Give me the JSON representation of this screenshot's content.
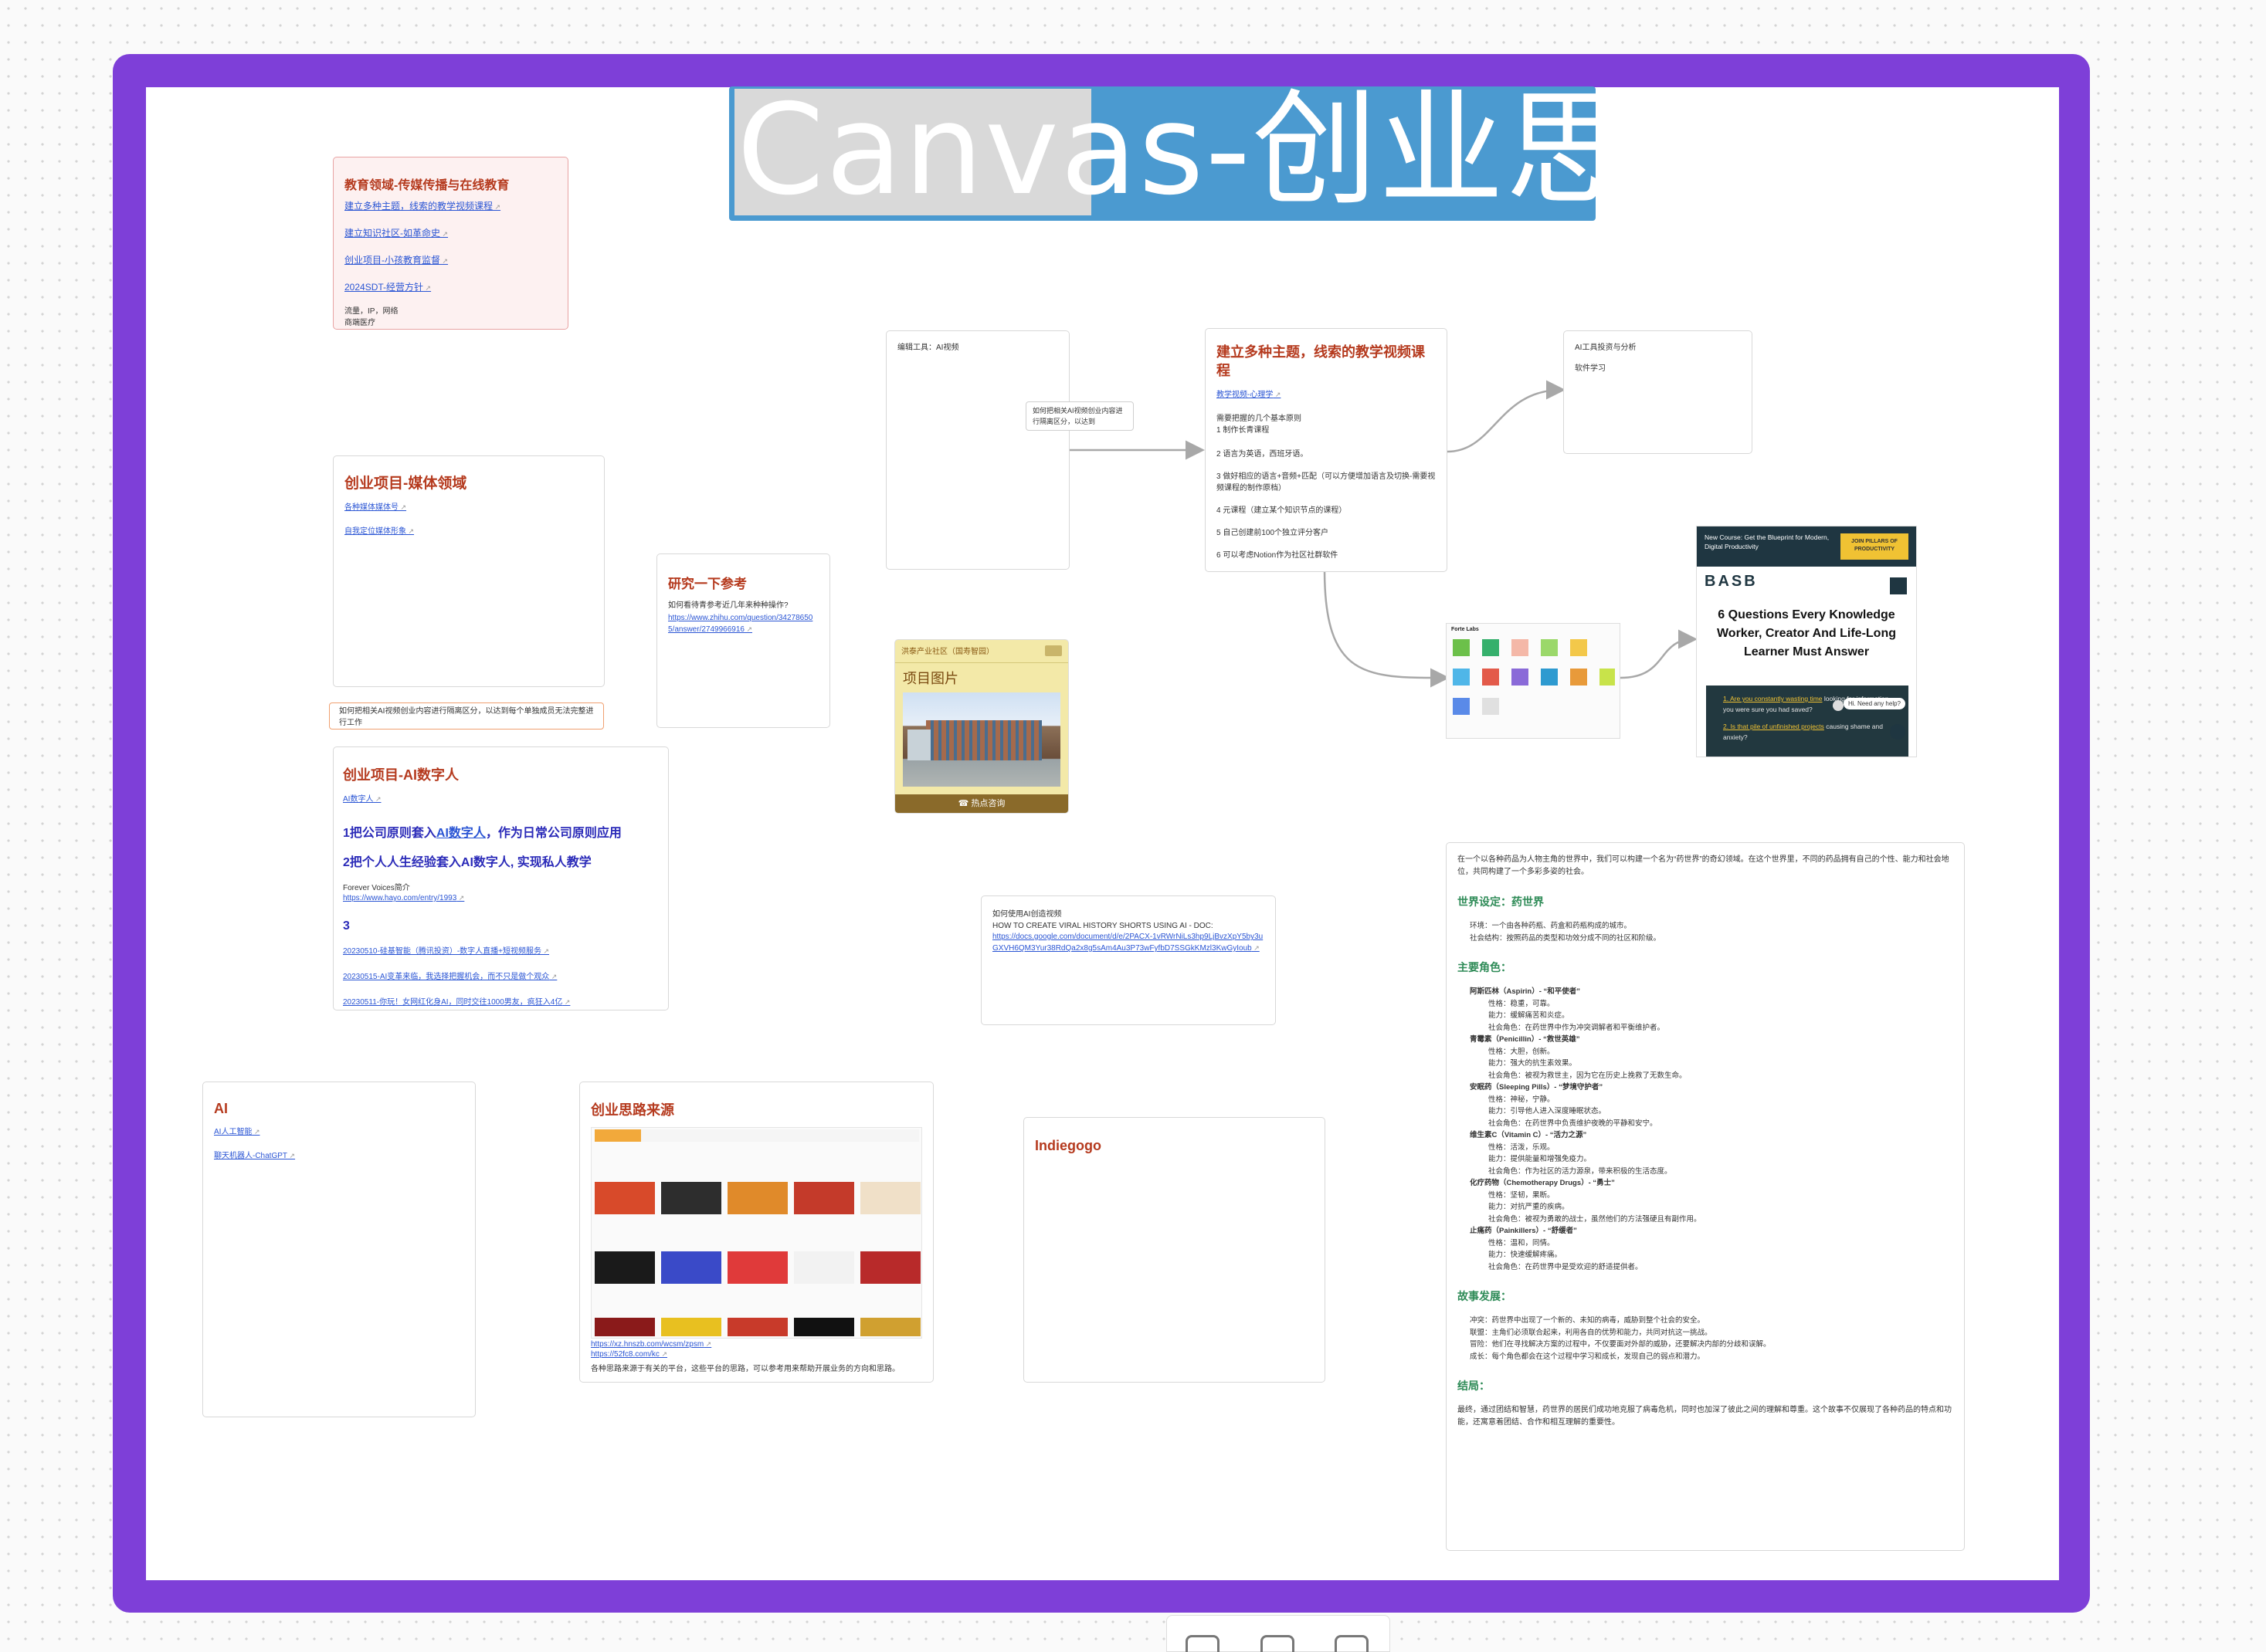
{
  "page": {
    "title": "Canvas-创业思路",
    "title_part1": "Canvas",
    "title_part2": "-创业思路"
  },
  "edu": {
    "title": "教育领域-传媒传播与在线教育",
    "links": [
      "建立多种主题，线索的教学视频课程",
      "建立知识社区-如革命史",
      "创业项目-小孩教育监督",
      "2024SDT-经营方针"
    ],
    "note1": "流量，IP，网络",
    "note2": "商端医疗"
  },
  "media": {
    "title": "创业项目-媒体领域",
    "links": [
      "各种媒体媒体号",
      "自我定位媒体形象"
    ]
  },
  "orange_note": "如何把相关AI视频创业内容进行隔离区分，以达到每个单独成员无法完整进行工作",
  "research": {
    "title": "研究一下参考",
    "text": "如何看待青参考近几年来种种操作?",
    "link": "https://www.zhihu.com/question/342786505/answer/2749966916"
  },
  "ai_human": {
    "title": "创业项目-AI数字人",
    "link1": "AI数字人",
    "line1_prefix": "1把公司原则套入",
    "line1_link": "AI数字人",
    "line1_suffix": "，作为日常公司原则应用",
    "line2": "2把个人人生经验套入AI数字人, 实现私人教学",
    "fv_label": "Forever Voices简介",
    "fv_link": "https://www.hayo.com/entry/1993",
    "num3": "3",
    "links": [
      "20230510-硅基智能（腾讯投资）-数字人直播+短视频服务",
      "20230515-AI变革来临，我选择把握机会，而不只是做个观众",
      "20230511-你玩！女网红化身AI，同时交往1000男友，疯狂入4亿"
    ]
  },
  "edit_tool": {
    "label": "编辑工具：AI视频"
  },
  "small_note": "如何把相关AI视频创业内容进行隔离区分，以达到",
  "project_card": {
    "header": "洪泰产业社区（国寿智园）",
    "label": "项目图片",
    "footer": "☎ 热点咨询"
  },
  "course": {
    "title": "建立多种主题，线索的教学视频课程",
    "link": "教学视频-心理学",
    "lines": [
      "需要把握的几个基本原则",
      "1 制作长青课程",
      "2 语言为英语，西班牙语。",
      "3 做好相应的语言+音频+匹配（可以方便增加语言及切换-需要视频课程的制作原档）",
      "4 元课程（建立某个知识节点的课程）",
      "5 自己创建前100个独立评分客户",
      "6 可以考虑Notion作为社区社群软件"
    ]
  },
  "ai_tools": {
    "line1": "AI工具投资与分析",
    "line2": "软件学习"
  },
  "basb": {
    "banner": "New Course: Get the Blueprint for Modern, Digital Productivity",
    "cta": "JOIN PILLARS OF PRODUCTIVITY",
    "logo": "BASB",
    "headline": "6 Questions Every Knowledge Worker, Creator And Life-Long Learner Must Answer",
    "q1_link": "1. Are you constantly wasting time",
    "q1_rest": " looking for information you were sure you had saved?",
    "q2_link": "2. Is that pile of unfinished projects",
    "q2_rest": " causing shame and anxiety?",
    "chat": "Hi. Need any help?"
  },
  "forte": {
    "title": "Forte Labs"
  },
  "viral": {
    "line1": "如何使用AI创造视频",
    "line2": "HOW TO CREATE VIRAL HISTORY SHORTS USING AI - DOC:",
    "link": "https://docs.google.com/document/d/e/2PACX-1vRWrNiLs3hp9LjBvzXpY5by3uGXVH6QM3Yur38RdQa2x8g5sAm4Au3P73wFyfbD7SSGkKMzl3KwGyIoub"
  },
  "ai_card": {
    "title": "AI",
    "links": [
      "AI人工智能",
      "聊天机器人-ChatGPT"
    ]
  },
  "source": {
    "title": "创业思路来源",
    "links": [
      "https://xz.hnszb.com/wcsm/zpsm",
      "https://52fc8.com/kc"
    ],
    "footer": "各种思路来源于有关的平台，这些平台的思路，可以参考用来帮助开展业务的方向和思路。"
  },
  "indiegogo": {
    "title": "Indiegogo"
  },
  "story": {
    "intro": "在一个以各种药品为人物主角的世界中，我们可以构建一个名为“药世界”的奇幻领域。在这个世界里，不同的药品拥有自己的个性、能力和社会地位，共同构建了一个多彩多姿的社会。",
    "world_title": "世界设定：药世界",
    "world": [
      "环境：一个由各种药瓶、药盒和药瓶构成的城市。",
      "社会结构：按照药品的类型和功效分成不同的社区和阶级。"
    ],
    "chars_title": "主要角色：",
    "chars": [
      {
        "name": "阿斯匹林（Aspirin）- “和平使者”",
        "attrs": [
          "性格：稳重，可靠。",
          "能力：缓解痛苦和炎症。",
          "社会角色：在药世界中作为冲突调解者和平衡维护者。"
        ]
      },
      {
        "name": "青霉素（Penicillin）- “救世英雄”",
        "attrs": [
          "性格：大胆，创新。",
          "能力：强大的抗生素效果。",
          "社会角色：被视为救世主，因为它在历史上挽救了无数生命。"
        ]
      },
      {
        "name": "安眠药（Sleeping Pills）- “梦境守护者”",
        "attrs": [
          "性格：神秘，宁静。",
          "能力：引导他人进入深度睡眠状态。",
          "社会角色：在药世界中负责维护夜晚的平静和安宁。"
        ]
      },
      {
        "name": "维生素C（Vitamin C）- “活力之源”",
        "attrs": [
          "性格：活泼，乐观。",
          "能力：提供能量和增强免疫力。",
          "社会角色：作为社区的活力源泉，带来积极的生活态度。"
        ]
      },
      {
        "name": "化疗药物（Chemotherapy Drugs）- “勇士”",
        "attrs": [
          "性格：坚韧，果断。",
          "能力：对抗严重的疾病。",
          "社会角色：被视为勇敢的战士，虽然他们的方法强硬且有副作用。"
        ]
      },
      {
        "name": "止痛药（Painkillers）- “舒缓者”",
        "attrs": [
          "性格：温和，同情。",
          "能力：快速缓解疼痛。",
          "社会角色：在药世界中是受欢迎的舒适提供者。"
        ]
      }
    ],
    "plot_title": "故事发展：",
    "plot": [
      "冲突：药世界中出现了一个新的、未知的病毒，威胁到整个社会的安全。",
      "联盟：主角们必须联合起来，利用各自的优势和能力，共同对抗这一挑战。",
      "冒险：他们在寻找解决方案的过程中，不仅要面对外部的威胁，还要解决内部的分歧和误解。",
      "成长：每个角色都会在这个过程中学习和成长，发现自己的弱点和潜力。"
    ],
    "end_title": "结局：",
    "ending": "最终，通过团结和智慧，药世界的居民们成功地克服了病毒危机，同时也加深了彼此之间的理解和尊重。这个故事不仅展现了各种药品的特点和功能，还寓意着团结、合作和相互理解的重要性。"
  }
}
